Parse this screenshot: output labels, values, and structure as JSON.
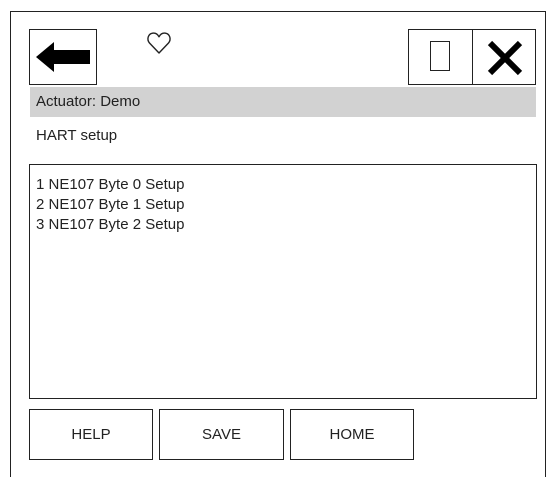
{
  "toolbar": {
    "back_icon": "left-arrow-icon",
    "favorite_icon": "heart-icon",
    "window_icon": "square-icon",
    "close_icon": "close-x-icon"
  },
  "header": {
    "title": "Actuator: Demo",
    "subtitle": "HART setup"
  },
  "menu": {
    "items": [
      {
        "label": "1 NE107 Byte 0 Setup"
      },
      {
        "label": "2 NE107 Byte 1 Setup"
      },
      {
        "label": "3 NE107 Byte 2 Setup"
      }
    ]
  },
  "buttons": {
    "help": "HELP",
    "save": "SAVE",
    "home": "HOME"
  },
  "colors": {
    "title_bar_bg": "#d2d2d2",
    "border": "#222222"
  }
}
